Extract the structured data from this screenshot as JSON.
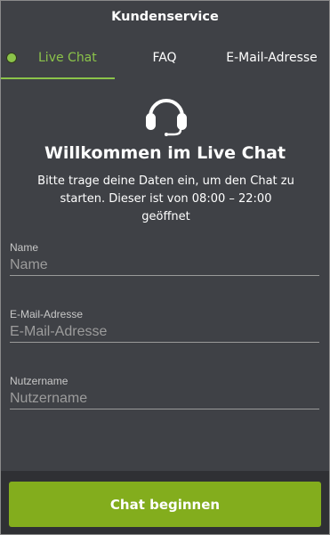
{
  "header": {
    "title": "Kundenservice"
  },
  "tabs": [
    {
      "label": "Live Chat",
      "active": true
    },
    {
      "label": "FAQ",
      "active": false
    },
    {
      "label": "E-Mail-Adresse",
      "active": false
    }
  ],
  "welcome": {
    "icon": "headset-icon",
    "title": "Willkommen im Live Chat",
    "subtitle": "Bitte trage deine Daten ein, um den Chat zu starten. Dieser ist von 08:00 – 22:00 geöffnet"
  },
  "form": {
    "name": {
      "label": "Name",
      "placeholder": "Name",
      "value": ""
    },
    "email": {
      "label": "E-Mail-Adresse",
      "placeholder": "E-Mail-Adresse",
      "value": ""
    },
    "username": {
      "label": "Nutzername",
      "placeholder": "Nutzername",
      "value": ""
    }
  },
  "actions": {
    "start_label": "Chat beginnen"
  },
  "colors": {
    "accent": "#8bc34a",
    "button": "#83ad1d",
    "panel": "#3f4146",
    "footer": "#2f3034"
  }
}
